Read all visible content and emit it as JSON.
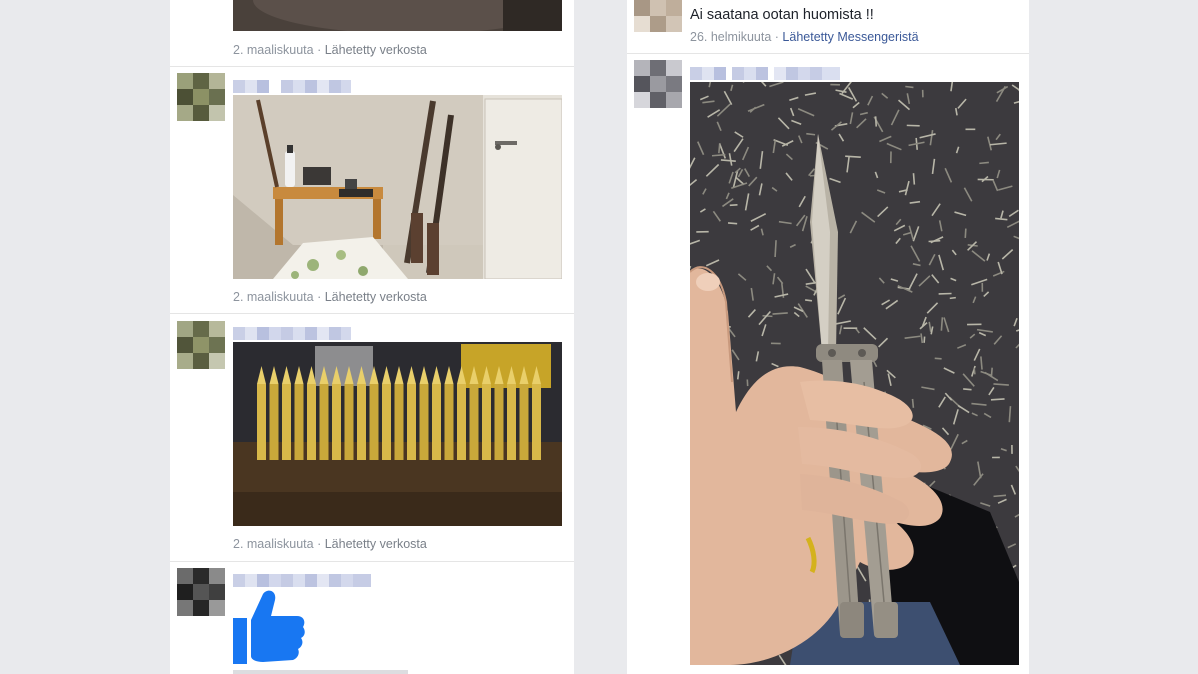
{
  "left_column": {
    "messages": [
      {
        "date": "2. maaliskuuta",
        "separator": " · ",
        "source": "Lähetetty verkosta",
        "attachment": "photo"
      },
      {
        "date": "2. maaliskuuta",
        "separator": " · ",
        "source": "Lähetetty verkosta",
        "attachment": "photo"
      },
      {
        "date": "2. maaliskuuta",
        "separator": " · ",
        "source": "Lähetetty verkosta",
        "attachment": "photo"
      },
      {
        "attachment": "like-sticker"
      }
    ]
  },
  "right_column": {
    "messages": [
      {
        "text": "Ai saatana ootan huomista !!",
        "date": "26. helmikuuta",
        "separator": " · ",
        "source": "Lähetetty Messengeristä"
      },
      {
        "attachment": "photo"
      }
    ]
  },
  "colors": {
    "page_background": "#e9eaed",
    "panel_background": "#ffffff",
    "meta_text": "#8d949e",
    "link": "#3b5998",
    "like_blue": "#1877f2"
  },
  "icons": [
    "like-thumb-icon"
  ]
}
